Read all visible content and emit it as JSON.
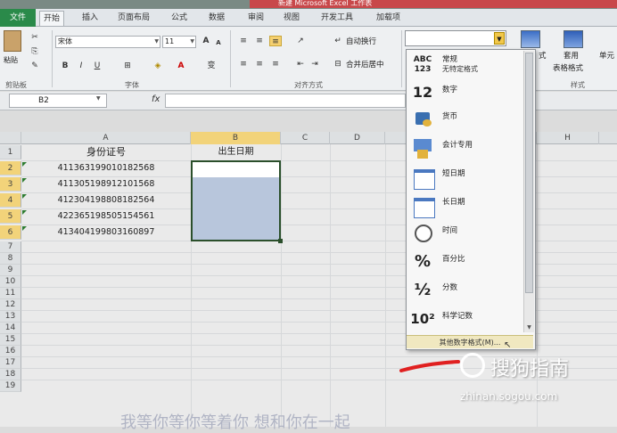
{
  "window": {
    "title": "新建 Microsoft Excel 工作表"
  },
  "tabs": [
    "文件",
    "开始",
    "插入",
    "页面布局",
    "公式",
    "数据",
    "审阅",
    "视图",
    "开发工具",
    "加载项"
  ],
  "ribbon": {
    "paste": "粘贴",
    "clipboard": "剪贴板",
    "font_name": "宋体",
    "font_size": "11",
    "font_group": "字体",
    "align_group": "对齐方式",
    "wrap": "自动换行",
    "merge": "合并后居中",
    "format_table": "套用",
    "format_table2": "表格格式",
    "cond_fmt_partial": "式",
    "style_partial": "单元",
    "styles_group": "样式"
  },
  "name_box": "B2",
  "fx": "fx",
  "columns": [
    "A",
    "B",
    "C",
    "D",
    "H"
  ],
  "rows": [
    "1",
    "2",
    "3",
    "4",
    "5",
    "6",
    "7",
    "8",
    "9",
    "10",
    "11",
    "12",
    "13",
    "14",
    "15",
    "16",
    "17",
    "18",
    "19"
  ],
  "cells": {
    "A1": "身份证号",
    "B1": "出生日期",
    "A2": "411363199010182568",
    "A3": "411305198912101568",
    "A4": "412304198808182564",
    "A5": "422365198505154561",
    "A6": "413404199803160897"
  },
  "format_menu": {
    "items": [
      {
        "icon": "ABC 123",
        "label": "常规",
        "sub": "无特定格式"
      },
      {
        "icon": "12",
        "label": "数字"
      },
      {
        "icon": "currency",
        "label": "货币"
      },
      {
        "icon": "accounting",
        "label": "会计专用"
      },
      {
        "icon": "calendar",
        "label": "短日期"
      },
      {
        "icon": "calendar",
        "label": "长日期"
      },
      {
        "icon": "clock",
        "label": "时间"
      },
      {
        "icon": "%",
        "label": "百分比"
      },
      {
        "icon": "½",
        "label": "分数"
      },
      {
        "icon": "10²",
        "label": "科学记数"
      }
    ],
    "more": "其他数字格式(M)..."
  },
  "watermark": {
    "brand": "搜狗指南",
    "url": "zhinan.sogou.com"
  },
  "caption": "我等你等你等着你 想和你在一起"
}
